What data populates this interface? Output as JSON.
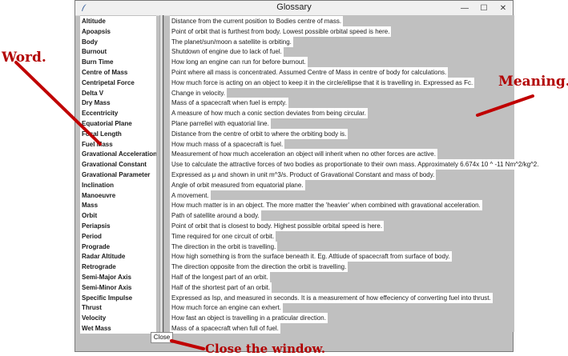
{
  "window": {
    "title": "Glossary",
    "icon": "feather-icon"
  },
  "terms": [
    "Altitude",
    "Apoapsis",
    "Body",
    "Burnout",
    "Burn Time",
    "Centre of Mass",
    "Centripetal Force",
    "Delta V",
    "Dry Mass",
    "Eccentricity",
    "Equatorial Plane",
    "Focal Length",
    "Fuel Mass",
    "Gravational Acceleration",
    "Gravational Constant",
    "Gravational Parameter",
    "Inclination",
    "Manoeuvre",
    "Mass",
    "Orbit",
    "Periapsis",
    "Period",
    "Prograde",
    "Radar Altitude",
    "Retrograde",
    "Semi-Major Axis",
    "Semi-Minor Axis",
    "Specific Impulse",
    "Thrust",
    "Velocity",
    "Wet Mass"
  ],
  "meanings": [
    "Distance from the current position to Bodies centre of mass.",
    "Point of orbit that is furthest from body. Lowest possible orbital speed is here.",
    "The planet/sun/moon a satellite is orbiting.",
    "Shutdown of engine due to lack of fuel.",
    "How long an engine can run for before burnout.",
    "Point where all mass is concentrated. Assumed Centre of Mass in centre of body for calculations.",
    "How much force is acting on an object to keep it in the circle/ellipse that it is travelling in. Expressed as Fc.",
    "Change in velocity.",
    "Mass of a spacecraft when fuel is empty.",
    "A measure of how much a conic section deviates from being circular.",
    "Plane parrellel with equatorial line.",
    "Distance from the centre of orbit to where the orbiting body is.",
    "How much mass of a spacecraft is fuel.",
    "Measurement of how much acceleration an object will inherit when no other forces are active.",
    "Use to calculate the attractive forces of two bodies as proportionate to their own mass. Approximately 6.674x 10 ^ -11 Nm^2/kg^2.",
    "Expressed as μ and shown in unit m^3/s. Product of Gravational Constant and mass of body.",
    "Angle of orbit measured from equatorial plane.",
    "A movement.",
    "How much matter is in an object. The more matter the 'heavier' when combined with gravational acceleration.",
    "Path of satellite around a body.",
    "Point of orbit that is closest to body. Highest possible orbital speed is here.",
    "Time required for one circuit of orbit.",
    "The direction in the orbit is travelling.",
    "How high something is from the surface beneath it. Eg. Atltiude of spacecraft from surface of body.",
    "The direction opposite from the direction the orbit is travelling.",
    "Half of the longest part of an orbit.",
    "Half of the shortest part of an orbit.",
    "Expressed as Isp, and measured in seconds. It is a measurement of how effeciency of converting fuel into thrust.",
    "How much force an engine can exhert.",
    "How fast an object is travelling in a praticular direction.",
    "Mass of a spacecraft when full of fuel."
  ],
  "buttons": {
    "close_label": "Close"
  },
  "annotations": {
    "word": "Word.",
    "meaning": "Meaning.",
    "close": "Close the window."
  },
  "colors": {
    "annotation": "#b20000",
    "panel": "#c0c0c0",
    "cell": "#ffffff"
  }
}
